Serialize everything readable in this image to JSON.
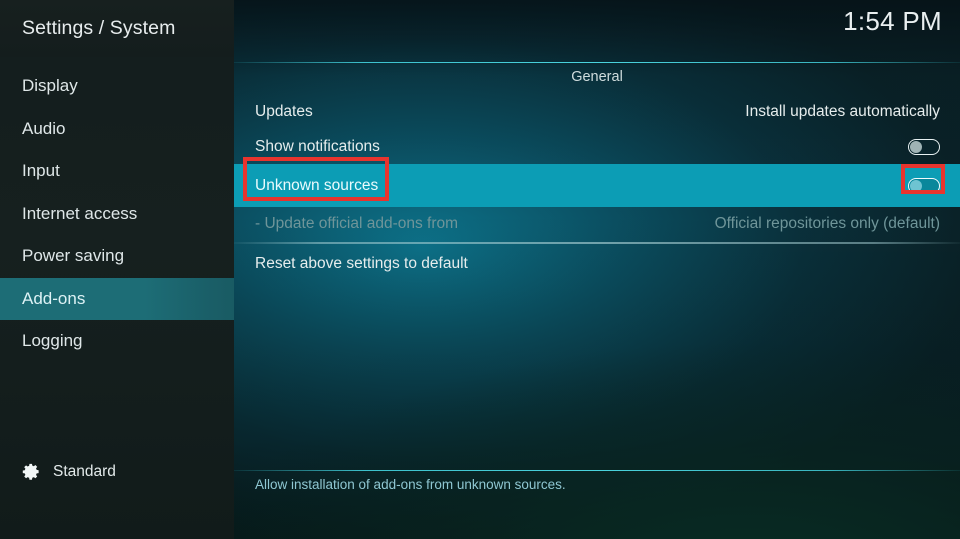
{
  "window": {
    "title": "Settings / System",
    "clock": "1:54 PM"
  },
  "sidebar": {
    "items": [
      {
        "label": "Display",
        "selected": false
      },
      {
        "label": "Audio",
        "selected": false
      },
      {
        "label": "Input",
        "selected": false
      },
      {
        "label": "Internet access",
        "selected": false
      },
      {
        "label": "Power saving",
        "selected": false
      },
      {
        "label": "Add-ons",
        "selected": true
      },
      {
        "label": "Logging",
        "selected": false
      }
    ],
    "footer": {
      "icon": "gear-icon",
      "label": "Standard"
    }
  },
  "main": {
    "group_header": "General",
    "rows": [
      {
        "label": "Updates",
        "value": "Install updates automatically",
        "control": "text",
        "state": "normal"
      },
      {
        "label": "Show notifications",
        "value": "",
        "control": "toggle",
        "toggle_on": false,
        "state": "normal"
      },
      {
        "label": "Unknown sources",
        "value": "",
        "control": "toggle",
        "toggle_on": false,
        "state": "selected"
      },
      {
        "label": "- Update official add-ons from",
        "value": "Official repositories only (default)",
        "control": "text",
        "state": "disabled"
      },
      {
        "label": "Reset above settings to default",
        "value": "",
        "control": "none",
        "state": "normal"
      }
    ],
    "help_text": "Allow installation of add-ons from unknown sources."
  },
  "annotations": [
    {
      "name": "unknown-sources-label-highlight",
      "color": "#e8342e"
    },
    {
      "name": "unknown-sources-toggle-highlight",
      "color": "#e8342e"
    }
  ],
  "colors": {
    "selected_row": "#0c9db5",
    "sidebar_selected": "#1d6d76",
    "annotation_red": "#e8342e",
    "separator_cyan": "#50e2ec"
  }
}
